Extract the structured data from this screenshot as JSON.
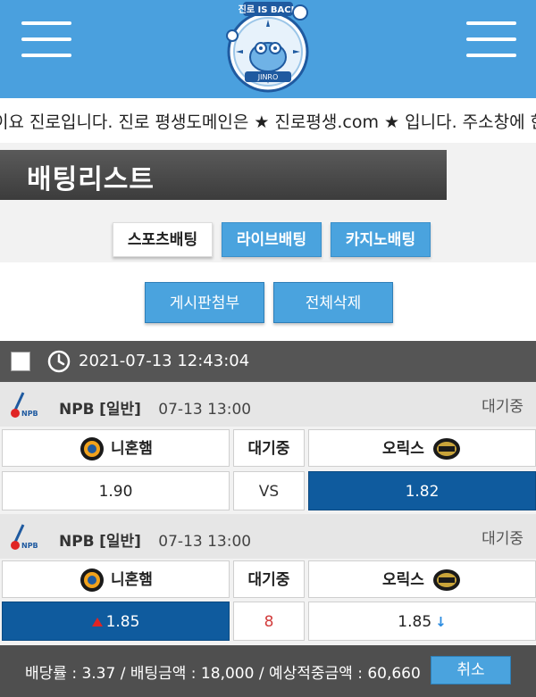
{
  "header": {
    "logo_text": "진로 IS BACK",
    "logo_sub": "JINRO",
    "menu_icon": "hamburger-icon",
    "colors": {
      "bar": "#4aa0de"
    }
  },
  "ticker": {
    "text": "이요 진로입니다. 진로 평생도메인은 ★ 진로평생.com ★ 입니다. 주소창에 한글로"
  },
  "page": {
    "title": "배팅리스트"
  },
  "tabs": [
    {
      "label": "스포츠배팅",
      "active": true
    },
    {
      "label": "라이브배팅",
      "active": false
    },
    {
      "label": "카지노배팅",
      "active": false
    }
  ],
  "actions": {
    "attach_label": "게시판첨부",
    "delete_all_label": "전체삭제"
  },
  "slip": {
    "datetime": "2021-07-13 12:43:04",
    "matches": [
      {
        "league": "NPB",
        "type": "[일반]",
        "date": "07-13 13:00",
        "status": "대기중",
        "home": "니혼햄",
        "mid_label": "대기중",
        "away": "오릭스",
        "home_odd": "1.90",
        "mid_value": "VS",
        "away_odd": "1.82",
        "selected": "away"
      },
      {
        "league": "NPB",
        "type": "[일반]",
        "date": "07-13 13:00",
        "status": "대기중",
        "home": "니혼햄",
        "mid_label": "대기중",
        "away": "오릭스",
        "home_odd": "1.85",
        "mid_value": "8",
        "away_odd": "1.85",
        "selected": "home"
      }
    ]
  },
  "footer": {
    "summary": "배당률 : 3.37 / 배팅금액 : 18,000 / 예상적중금액 : 60,660",
    "cancel_label": "취소"
  }
}
